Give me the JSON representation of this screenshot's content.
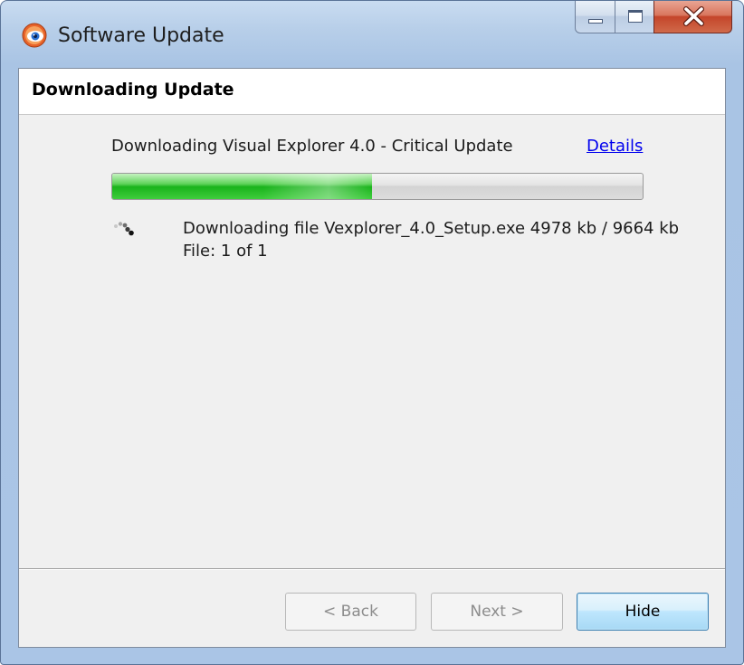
{
  "window": {
    "title": "Software Update",
    "controls": {
      "minimize": "minimize",
      "maximize": "maximize",
      "close": "close"
    }
  },
  "header": {
    "title": "Downloading Update"
  },
  "main": {
    "task_label": "Downloading Visual Explorer 4.0 - Critical Update",
    "details_link": "Details",
    "progress_fraction": 0.49,
    "file_status": "Downloading file Vexplorer_4.0_Setup.exe 4978 kb / 9664 kb",
    "file_count": "File: 1 of 1"
  },
  "footer": {
    "back_label": "< Back",
    "next_label": "Next >",
    "hide_label": "Hide",
    "back_enabled": false,
    "next_enabled": false,
    "hide_enabled": true
  },
  "icons": {
    "app": "app-eye-icon",
    "spinner": "loading-spinner-icon",
    "close": "close-icon"
  },
  "colors": {
    "progress_fill": "#19b31b",
    "link": "#0000ee",
    "close_button": "#c4452a",
    "default_button_border": "#3c7fb1"
  }
}
